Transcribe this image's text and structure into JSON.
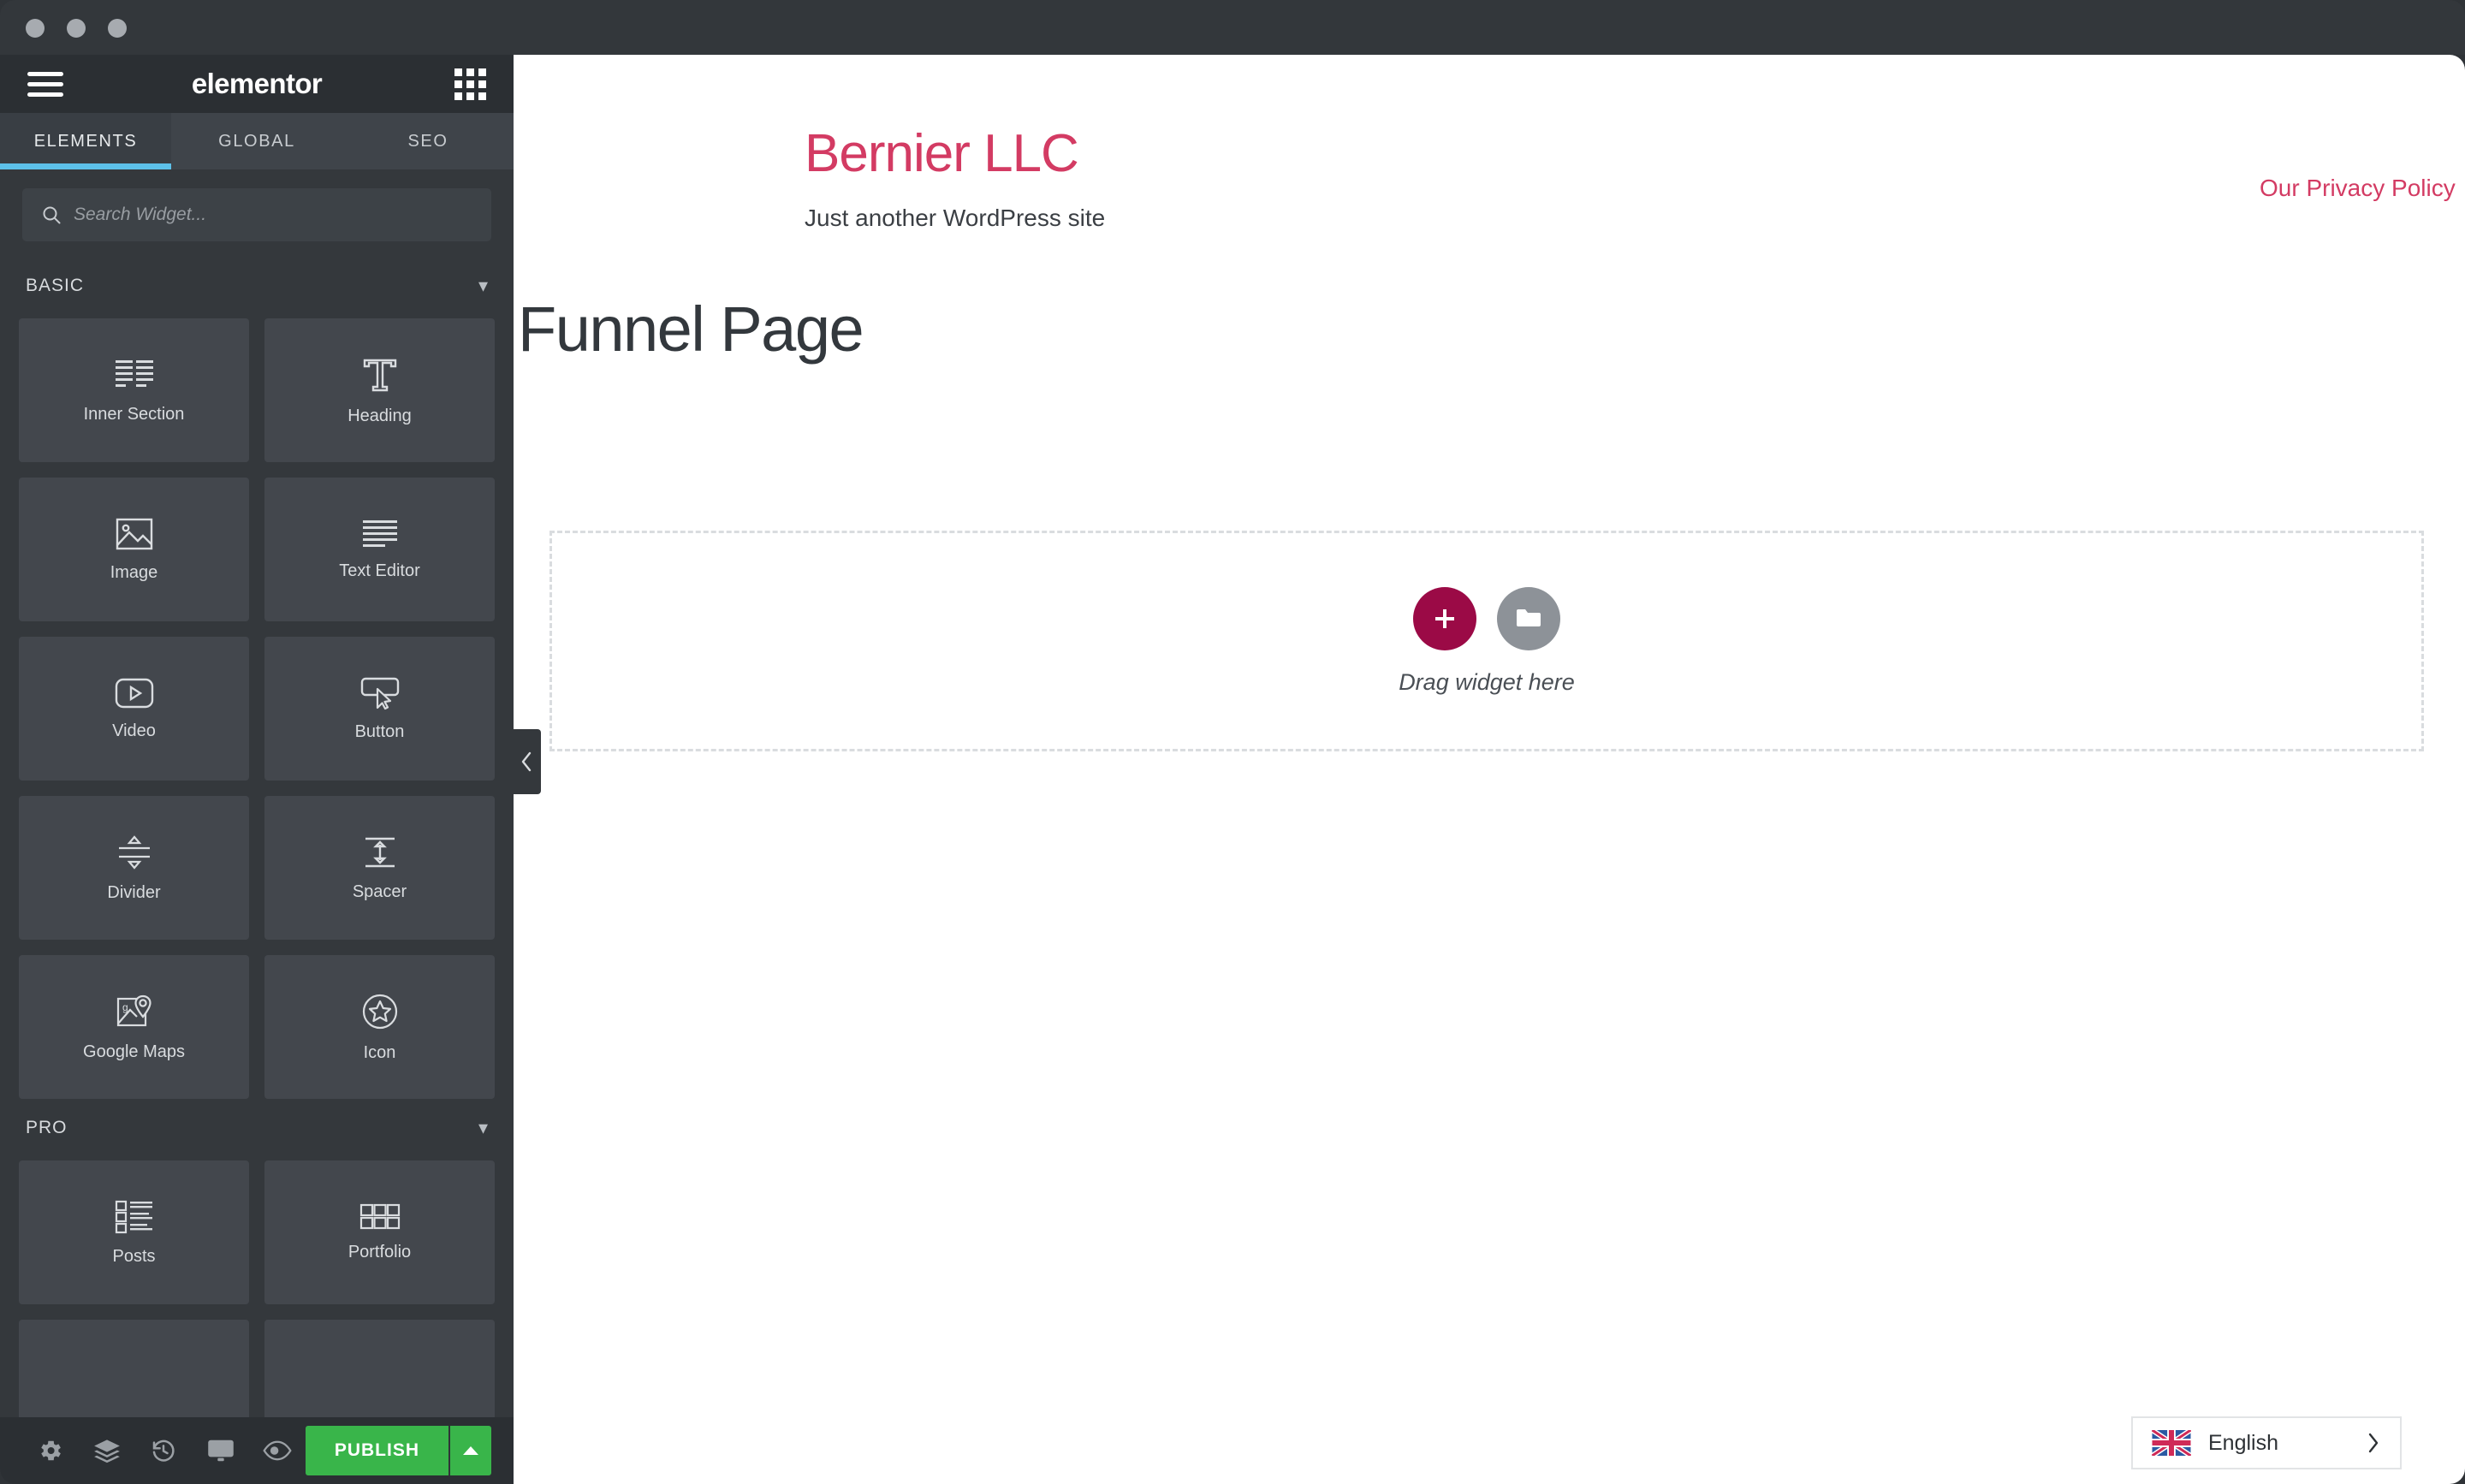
{
  "window": {
    "traffic_lights": [
      "close",
      "minimize",
      "zoom"
    ]
  },
  "panel": {
    "brand": "elementor",
    "menu_icon": "hamburger-menu-icon",
    "apps_icon": "apps-grid-icon",
    "tabs": [
      {
        "label": "ELEMENTS",
        "active": true
      },
      {
        "label": "GLOBAL",
        "active": false
      },
      {
        "label": "SEO",
        "active": false
      }
    ],
    "search": {
      "placeholder": "Search Widget...",
      "value": "",
      "icon": "search-icon"
    },
    "sections": [
      {
        "title": "BASIC",
        "collapse_icon": "chevron-down-icon",
        "widgets": [
          {
            "label": "Inner Section",
            "icon": "inner-section-icon"
          },
          {
            "label": "Heading",
            "icon": "heading-t-icon"
          },
          {
            "label": "Image",
            "icon": "image-icon"
          },
          {
            "label": "Text Editor",
            "icon": "text-editor-icon"
          },
          {
            "label": "Video",
            "icon": "video-play-icon"
          },
          {
            "label": "Button",
            "icon": "button-cursor-icon"
          },
          {
            "label": "Divider",
            "icon": "divider-icon"
          },
          {
            "label": "Spacer",
            "icon": "spacer-icon"
          },
          {
            "label": "Google Maps",
            "icon": "google-maps-pin-icon"
          },
          {
            "label": "Icon",
            "icon": "star-circle-icon"
          }
        ]
      },
      {
        "title": "PRO",
        "collapse_icon": "chevron-down-icon",
        "widgets": [
          {
            "label": "Posts",
            "icon": "posts-list-icon"
          },
          {
            "label": "Portfolio",
            "icon": "portfolio-grid-icon"
          }
        ]
      }
    ],
    "footer": {
      "icons": [
        {
          "name": "settings-gear-icon",
          "title": "Settings"
        },
        {
          "name": "navigator-layers-icon",
          "title": "Navigator"
        },
        {
          "name": "history-clock-icon",
          "title": "History"
        },
        {
          "name": "responsive-monitor-icon",
          "title": "Responsive Mode"
        },
        {
          "name": "preview-eye-icon",
          "title": "Preview Changes"
        }
      ],
      "publish_label": "PUBLISH",
      "publish_caret_icon": "caret-up-icon",
      "publish_color": "#39b54a"
    },
    "collapse_tab_icon": "chevron-left-icon"
  },
  "canvas": {
    "site_title": "Bernier LLC",
    "site_tagline": "Just another WordPress site",
    "privacy_link": "Our Privacy Policy",
    "page_title": "Funnel Page",
    "drop_zone": {
      "hint": "Drag widget here",
      "add_section_icon": "plus-icon",
      "add_template_icon": "folder-icon",
      "add_section_color": "#9b0a46",
      "add_template_color": "#8d9298"
    },
    "accent_color": "#d33b63"
  },
  "language_switcher": {
    "flag": "united-kingdom-flag",
    "label": "English",
    "chevron_icon": "chevron-right-icon"
  }
}
